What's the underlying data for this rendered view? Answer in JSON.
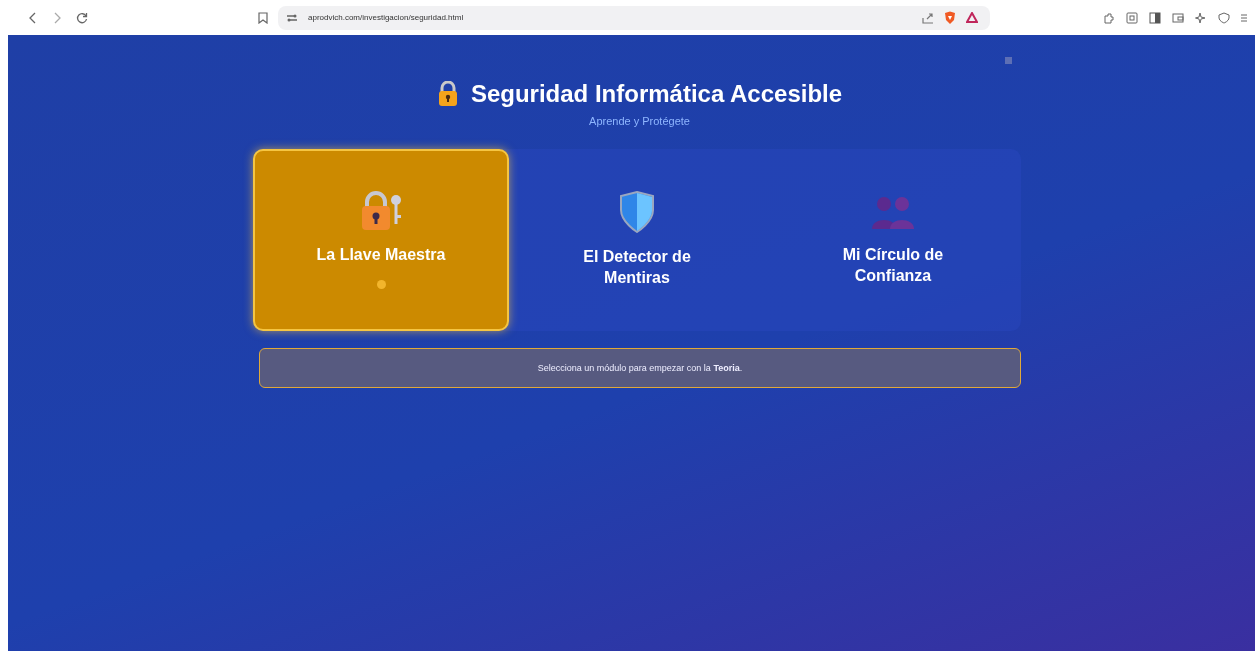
{
  "browser": {
    "url": "aprodvich.com/investigacion/seguridad.html"
  },
  "header": {
    "title": "Seguridad Informática Accesible",
    "subtitle": "Aprende y Protégete"
  },
  "modules": [
    {
      "kind": "lock",
      "label": "La Llave Maestra",
      "selected": true
    },
    {
      "kind": "shield",
      "label": "El Detector de Mentiras",
      "selected": false
    },
    {
      "kind": "people",
      "label": "Mi Círculo de Confianza",
      "selected": false
    }
  ],
  "message": "Selecciona un módulo para empezar con la **Teoria**."
}
